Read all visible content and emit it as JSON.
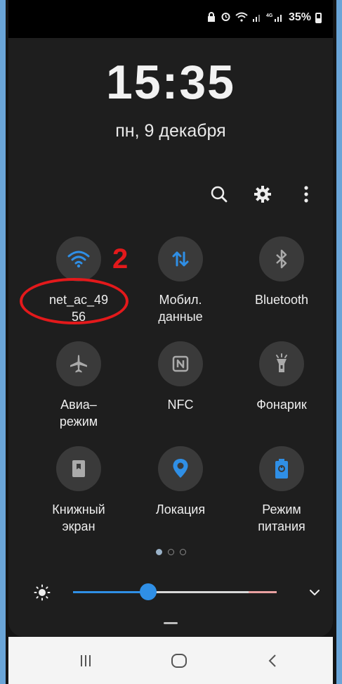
{
  "status_bar": {
    "battery": "35%",
    "icons": [
      "lock-notification-icon",
      "alarm-icon",
      "wifi-signal-icon",
      "cell-signal-icon",
      "4g-signal-icon",
      "battery-icon"
    ]
  },
  "lock": {
    "time": "15:35",
    "date": "пн, 9 декабря"
  },
  "actions": [
    "search-icon",
    "gear-icon",
    "more-icon"
  ],
  "tiles": [
    {
      "label": "net_ac_49\n56",
      "icon": "wifi-icon",
      "active": true
    },
    {
      "label": "Мобил.\nданные",
      "icon": "mobile-data-icon",
      "active": true
    },
    {
      "label": "Bluetooth",
      "icon": "bluetooth-icon",
      "active": false
    },
    {
      "label": "Авиа–\nрежим",
      "icon": "airplane-icon",
      "active": false
    },
    {
      "label": "NFC",
      "icon": "nfc-icon",
      "active": false
    },
    {
      "label": "Фонарик",
      "icon": "flashlight-icon",
      "active": false
    },
    {
      "label": "Книжный\nэкран",
      "icon": "book-screen-icon",
      "active": false
    },
    {
      "label": "Локация",
      "icon": "location-icon",
      "active": true
    },
    {
      "label": "Режим\nпитания",
      "icon": "power-mode-icon",
      "active": true
    }
  ],
  "annotation": {
    "number": "2"
  },
  "pager": {
    "pages": 3,
    "current": 0
  },
  "brightness": {
    "level": 0.37
  },
  "colors": {
    "accent": "#2f8fe6",
    "annotation": "#e3191b",
    "panel": "#1e1e1e",
    "tile": "#3a3a3a"
  }
}
